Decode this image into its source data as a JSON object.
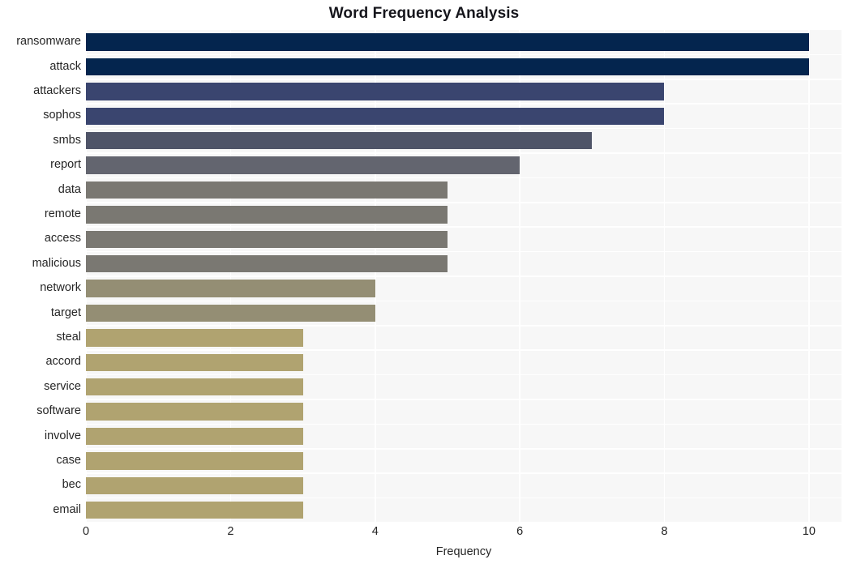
{
  "chart_data": {
    "type": "bar",
    "orientation": "horizontal",
    "title": "Word Frequency Analysis",
    "xlabel": "Frequency",
    "ylabel": "",
    "xlim": [
      0,
      10.45
    ],
    "xticks": [
      0,
      2,
      4,
      6,
      8,
      10
    ],
    "xtick_labels": [
      "0",
      "2",
      "4",
      "6",
      "8",
      "10"
    ],
    "grid": true,
    "grid_color": "#ffffff",
    "plot_background": "#f7f7f7",
    "figure_background": "#ffffff",
    "legend": null,
    "categories": [
      "ransomware",
      "attack",
      "attackers",
      "sophos",
      "smbs",
      "report",
      "data",
      "remote",
      "access",
      "malicious",
      "network",
      "target",
      "steal",
      "accord",
      "service",
      "software",
      "involve",
      "case",
      "bec",
      "email"
    ],
    "values": [
      10,
      10,
      8,
      8,
      7,
      6,
      5,
      5,
      5,
      5,
      4,
      4,
      3,
      3,
      3,
      3,
      3,
      3,
      3,
      3
    ],
    "bar_colors": [
      "#04254e",
      "#04254e",
      "#3a456f",
      "#3a456f",
      "#4f5468",
      "#63656f",
      "#7a7872",
      "#7a7872",
      "#7a7872",
      "#7a7872",
      "#948e74",
      "#948e74",
      "#b0a370",
      "#b0a370",
      "#b0a370",
      "#b0a370",
      "#b0a370",
      "#b0a370",
      "#b0a370",
      "#b0a370"
    ]
  }
}
